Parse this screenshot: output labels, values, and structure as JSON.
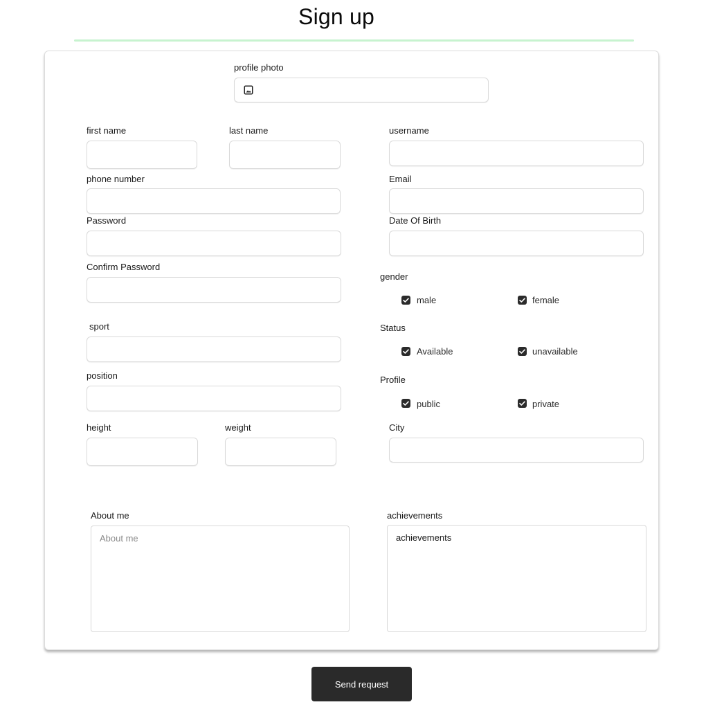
{
  "header": {
    "title": "Sign up"
  },
  "form": {
    "profile_photo_label": "profile photo",
    "first_name_label": "first name",
    "last_name_label": "last name",
    "username_label": "username",
    "phone_label": "phone number",
    "email_label": "Email",
    "password_label": "Password",
    "dob_label": "Date Of Birth",
    "confirm_password_label": "Confirm Password",
    "sport_label": "sport",
    "position_label": "position",
    "height_label": "height",
    "weight_label": "weight",
    "city_label": "City",
    "gender": {
      "label": "gender",
      "options": [
        "male",
        "female"
      ],
      "checked": [
        true,
        true
      ]
    },
    "status": {
      "label": "Status",
      "options": [
        "Available",
        "unavailable"
      ],
      "checked": [
        true,
        true
      ]
    },
    "profile": {
      "label": "Profile",
      "options": [
        "public",
        "private"
      ],
      "checked": [
        true,
        true
      ]
    },
    "about": {
      "label": "About me",
      "placeholder": "About me"
    },
    "achievements": {
      "label": "achievements",
      "value": "achievements"
    }
  },
  "actions": {
    "submit_label": "Send request"
  },
  "icons": {
    "photo": "image-icon",
    "check": "checkbox-checked-icon"
  }
}
